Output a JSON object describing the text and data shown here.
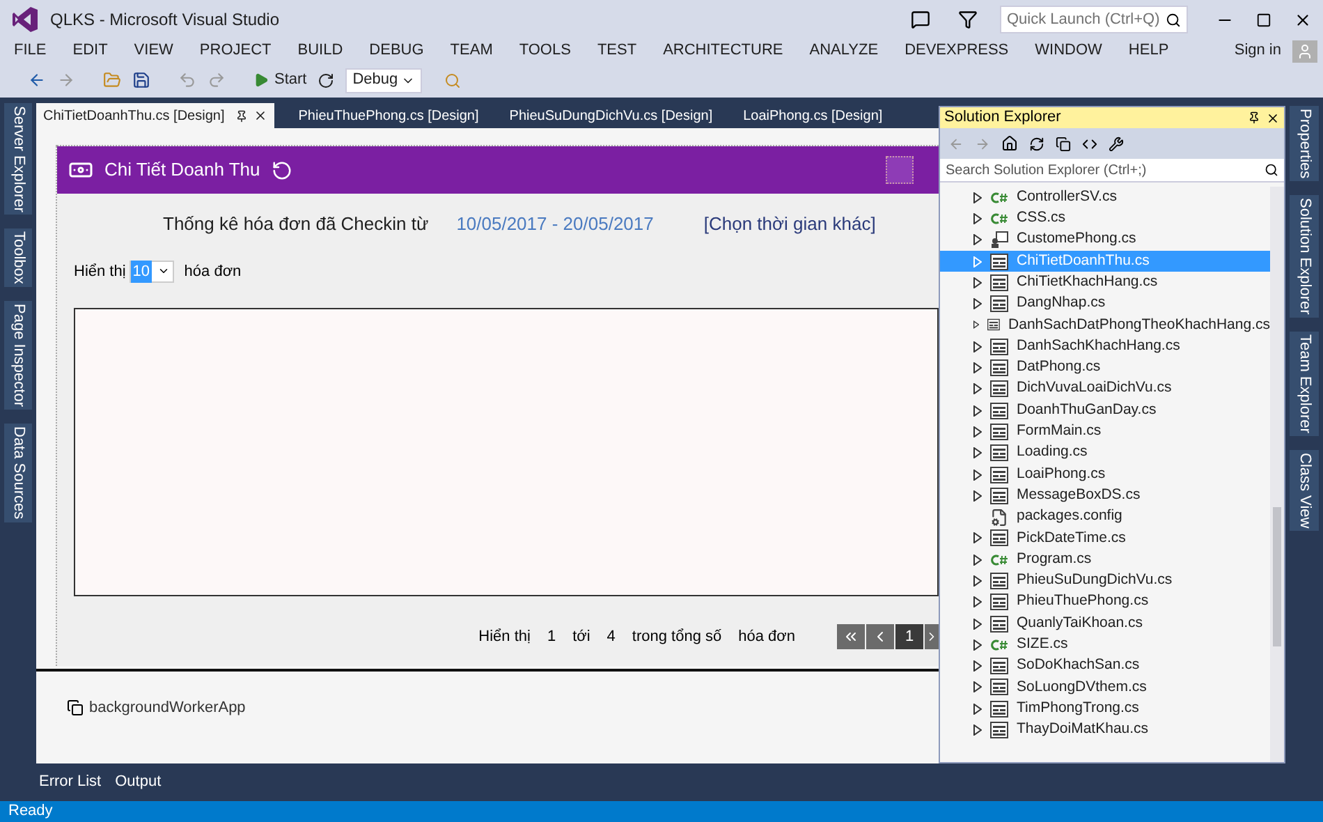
{
  "window": {
    "title": "QLKS - Microsoft Visual Studio",
    "quick_launch": {
      "placeholder": "Quick Launch (Ctrl+Q)"
    },
    "sign_in": "Sign in"
  },
  "menu": [
    "FILE",
    "EDIT",
    "VIEW",
    "PROJECT",
    "BUILD",
    "DEBUG",
    "TEAM",
    "TOOLS",
    "TEST",
    "ARCHITECTURE",
    "ANALYZE",
    "DEVEXPRESS",
    "WINDOW",
    "HELP"
  ],
  "toolbar": {
    "start": "Start",
    "configuration": "Debug"
  },
  "left_tabs": [
    "Server Explorer",
    "Toolbox",
    "Page Inspector",
    "Data Sources"
  ],
  "document_tabs": [
    {
      "label": "ChiTietDoanhThu.cs [Design]",
      "selected": true
    },
    {
      "label": "PhieuThuePhong.cs [Design]",
      "selected": false
    },
    {
      "label": "PhieuSuDungDichVu.cs [Design]",
      "selected": false
    },
    {
      "label": "LoaiPhong.cs [Design]",
      "selected": false
    }
  ],
  "form": {
    "title": "Chi Tiết Doanh Thu",
    "summary_label": "Thống kê hóa đơn đã Checkin từ",
    "date_range": "10/05/2017 - 20/05/2017",
    "change_link": "[Chọn thời gian khác]",
    "show_label": "Hiển thị",
    "page_size": "10",
    "show_suffix": "hóa đơn",
    "pager": {
      "texts": [
        "Hiển thị",
        "1",
        "tới",
        "4",
        "trong tổng số",
        "hóa đơn"
      ],
      "current_page": "1"
    }
  },
  "component_tray": [
    "backgroundWorkerApp"
  ],
  "solution_explorer": {
    "title": "Solution Explorer",
    "search": {
      "placeholder": "Search Solution Explorer (Ctrl+;)"
    },
    "items": [
      {
        "label": "ControllerSV.cs",
        "kind": "csharp",
        "expandable": true,
        "selected": false
      },
      {
        "label": "CSS.cs",
        "kind": "csharp",
        "expandable": true,
        "selected": false
      },
      {
        "label": "CustomePhong.cs",
        "kind": "control",
        "expandable": true,
        "selected": false
      },
      {
        "label": "ChiTietDoanhThu.cs",
        "kind": "form",
        "expandable": true,
        "selected": true
      },
      {
        "label": "ChiTietKhachHang.cs",
        "kind": "form",
        "expandable": true,
        "selected": false
      },
      {
        "label": "DangNhap.cs",
        "kind": "form",
        "expandable": true,
        "selected": false
      },
      {
        "label": "DanhSachDatPhongTheoKhachHang.cs",
        "kind": "form",
        "expandable": true,
        "selected": false
      },
      {
        "label": "DanhSachKhachHang.cs",
        "kind": "form",
        "expandable": true,
        "selected": false
      },
      {
        "label": "DatPhong.cs",
        "kind": "form",
        "expandable": true,
        "selected": false
      },
      {
        "label": "DichVuvaLoaiDichVu.cs",
        "kind": "form",
        "expandable": true,
        "selected": false
      },
      {
        "label": "DoanhThuGanDay.cs",
        "kind": "form",
        "expandable": true,
        "selected": false
      },
      {
        "label": "FormMain.cs",
        "kind": "form",
        "expandable": true,
        "selected": false
      },
      {
        "label": "Loading.cs",
        "kind": "form",
        "expandable": true,
        "selected": false
      },
      {
        "label": "LoaiPhong.cs",
        "kind": "form",
        "expandable": true,
        "selected": false
      },
      {
        "label": "MessageBoxDS.cs",
        "kind": "form",
        "expandable": true,
        "selected": false
      },
      {
        "label": "packages.config",
        "kind": "config",
        "expandable": false,
        "selected": false
      },
      {
        "label": "PickDateTime.cs",
        "kind": "form",
        "expandable": true,
        "selected": false
      },
      {
        "label": "Program.cs",
        "kind": "csharp",
        "expandable": true,
        "selected": false
      },
      {
        "label": "PhieuSuDungDichVu.cs",
        "kind": "form",
        "expandable": true,
        "selected": false
      },
      {
        "label": "PhieuThuePhong.cs",
        "kind": "form",
        "expandable": true,
        "selected": false
      },
      {
        "label": "QuanlyTaiKhoan.cs",
        "kind": "form",
        "expandable": true,
        "selected": false
      },
      {
        "label": "SIZE.cs",
        "kind": "csharp",
        "expandable": true,
        "selected": false
      },
      {
        "label": "SoDoKhachSan.cs",
        "kind": "form",
        "expandable": true,
        "selected": false
      },
      {
        "label": "SoLuongDVthem.cs",
        "kind": "form",
        "expandable": true,
        "selected": false
      },
      {
        "label": "TimPhongTrong.cs",
        "kind": "form",
        "expandable": true,
        "selected": false
      },
      {
        "label": "ThayDoiMatKhau.cs",
        "kind": "form",
        "expandable": true,
        "selected": false
      }
    ]
  },
  "right_tabs": [
    "Properties",
    "Solution Explorer",
    "Team Explorer",
    "Class View"
  ],
  "bottom_tabs": [
    "Error List",
    "Output"
  ],
  "status_bar": {
    "text": "Ready"
  }
}
